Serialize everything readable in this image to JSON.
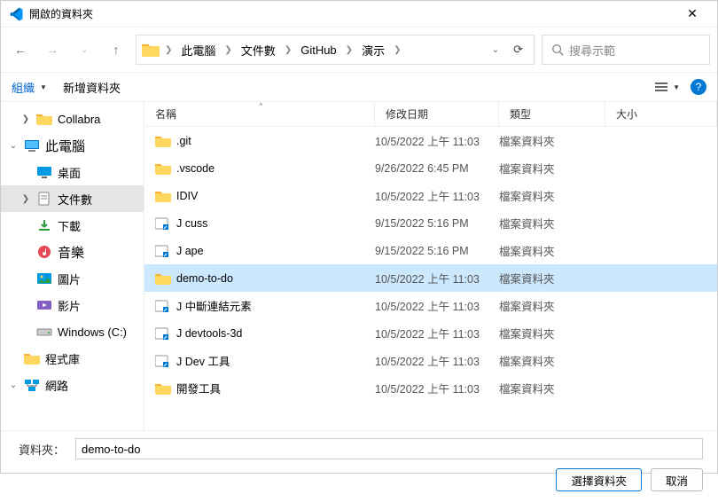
{
  "title": "開啟的資料夾",
  "breadcrumb": [
    "此電腦",
    "文件數",
    "GitHub",
    "演示"
  ],
  "search_placeholder": "搜尋示範",
  "toolbar": {
    "organize": "組織",
    "new_folder": "新增資料夾"
  },
  "columns": {
    "name": "名稱",
    "date": "修改日期",
    "type": "類型",
    "size": "大小"
  },
  "sidebar": [
    {
      "label": "Collabra",
      "icon": "folder",
      "indent": 1,
      "exp": ">"
    },
    {
      "label": "此電腦",
      "icon": "pc",
      "indent": 0,
      "exp": "v",
      "bold": true
    },
    {
      "label": "桌面",
      "icon": "desktop",
      "indent": 1,
      "exp": ""
    },
    {
      "label": "文件數",
      "icon": "documents",
      "indent": 1,
      "exp": ">",
      "selected": true
    },
    {
      "label": "下載",
      "icon": "downloads",
      "indent": 1,
      "exp": ""
    },
    {
      "label": "音樂",
      "icon": "music",
      "indent": 1,
      "exp": "",
      "bold": true
    },
    {
      "label": "圖片",
      "icon": "pictures",
      "indent": 1,
      "exp": ""
    },
    {
      "label": "影片",
      "icon": "videos",
      "indent": 1,
      "exp": ""
    },
    {
      "label": "Windows (C:)",
      "icon": "drive",
      "indent": 1,
      "exp": ""
    },
    {
      "label": "程式庫",
      "icon": "libraries",
      "indent": 0,
      "exp": "",
      "bold": false
    },
    {
      "label": "網路",
      "icon": "network",
      "indent": 0,
      "exp": "v"
    }
  ],
  "files": [
    {
      "name": ".git",
      "date": "10/5/2022 上午 11:03",
      "type": "檔案資料夾",
      "icon": "folder"
    },
    {
      "name": ".vscode",
      "date": "9/26/2022 6:45 PM",
      "type": "檔案資料夾",
      "icon": "folder"
    },
    {
      "name": "IDIV",
      "date": "10/5/2022 上午 11:03",
      "type": "檔案資料夾",
      "icon": "folder"
    },
    {
      "name": "J cuss",
      "date": "9/15/2022 5:16 PM",
      "type": "檔案資料夾",
      "icon": "shortcut"
    },
    {
      "name": "J ape",
      "date": "9/15/2022 5:16 PM",
      "type": "檔案資料夾",
      "icon": "shortcut"
    },
    {
      "name": "demo-to-do",
      "date": "10/5/2022 上午 11:03",
      "type": "檔案資料夾",
      "icon": "folder",
      "selected": true
    },
    {
      "name": "J 中斷連結元素",
      "date": "10/5/2022 上午 11:03",
      "type": "檔案資料夾",
      "icon": "shortcut"
    },
    {
      "name": "J devtools-3d",
      "date": "10/5/2022 上午 11:03",
      "type": "檔案資料夾",
      "icon": "shortcut"
    },
    {
      "name": "J Dev 工具",
      "date": "10/5/2022 上午 11:03",
      "type": "檔案資料夾",
      "icon": "shortcut"
    },
    {
      "name": "開發工具",
      "date": "10/5/2022 上午 11:03",
      "type": "檔案資料夾",
      "icon": "folder"
    }
  ],
  "folder_label": "資料夾：",
  "folder_value": "demo-to-do",
  "btn_select": "選擇資料夾",
  "btn_cancel": "取消"
}
